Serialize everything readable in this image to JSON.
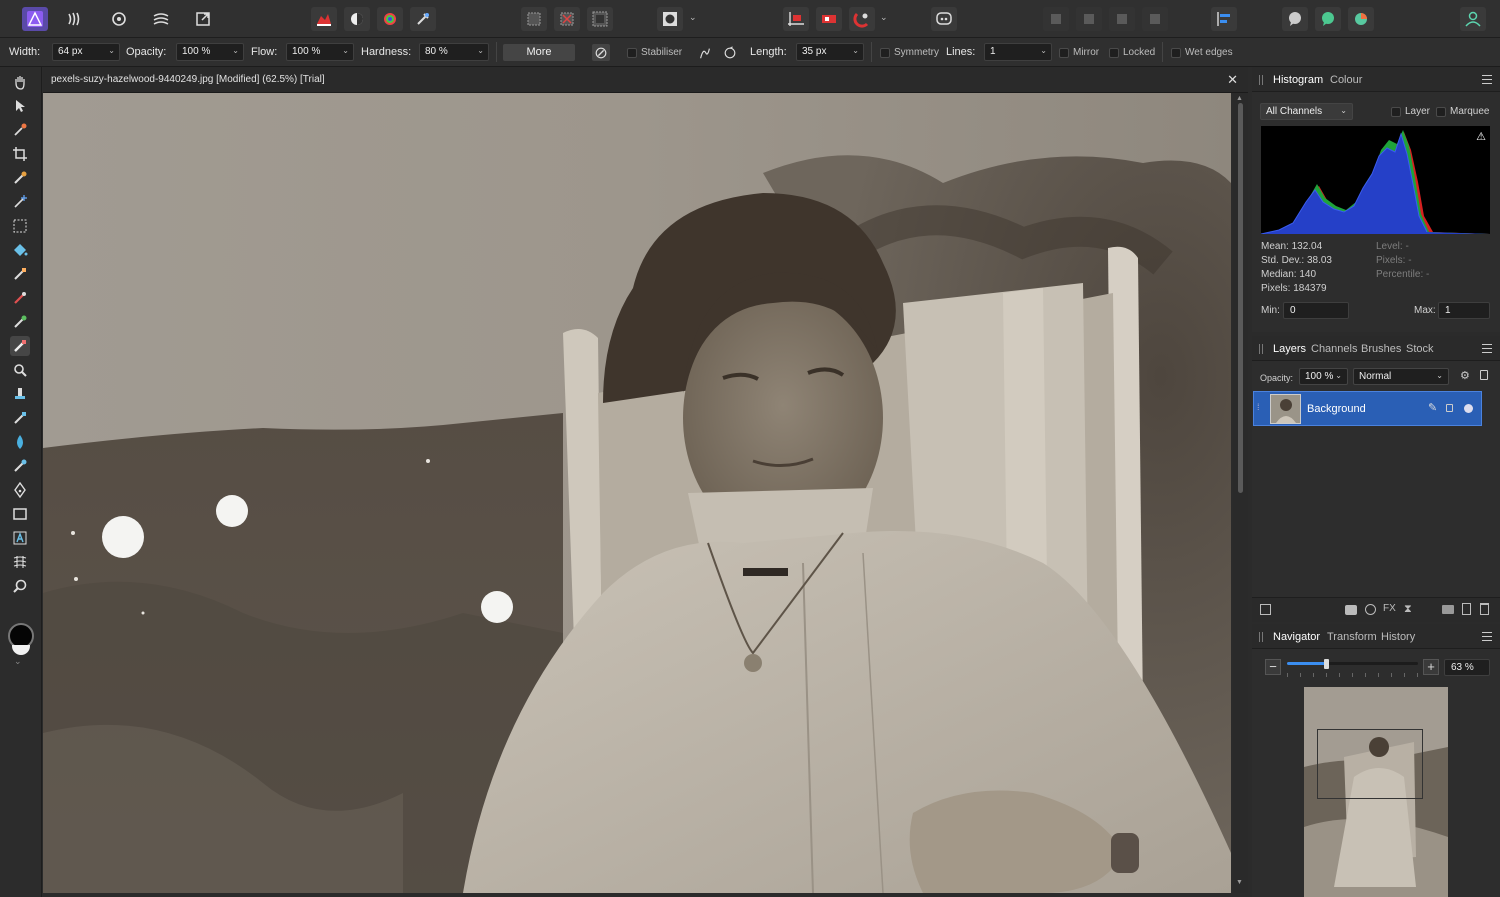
{
  "context_bar": {
    "width_label": "Width:",
    "width_value": "64 px",
    "opacity_label": "Opacity:",
    "opacity_value": "100 %",
    "flow_label": "Flow:",
    "flow_value": "100 %",
    "hardness_label": "Hardness:",
    "hardness_value": "80 %",
    "more_label": "More",
    "stabiliser_label": "Stabiliser",
    "length_label": "Length:",
    "length_value": "35 px",
    "symmetry_label": "Symmetry",
    "lines_label": "Lines:",
    "lines_value": "1",
    "mirror_label": "Mirror",
    "locked_label": "Locked",
    "wet_edges_label": "Wet edges"
  },
  "document": {
    "title": "pexels-suzy-hazelwood-9440249.jpg [Modified] (62.5%) [Trial]",
    "close_glyph": "✕"
  },
  "histogram_panel": {
    "tabs": [
      "Histogram",
      "Colour"
    ],
    "channels_value": "All Channels",
    "layer_label": "Layer",
    "marquee_label": "Marquee",
    "warning_glyph": "⚠",
    "stats": {
      "mean": "Mean: 132.04",
      "std_dev": "Std. Dev.: 38.03",
      "median": "Median: 140",
      "pixels": "Pixels: 184379",
      "level": "Level: -",
      "pixels_sel": "Pixels: -",
      "percentile": "Percentile: -"
    },
    "min_label": "Min:",
    "min_value": "0",
    "max_label": "Max:",
    "max_value": "1"
  },
  "layers_panel": {
    "tabs": [
      "Layers",
      "Channels",
      "Brushes",
      "Stock"
    ],
    "opacity_label": "Opacity:",
    "opacity_value": "100 %",
    "blend_value": "Normal",
    "layer_name": "Background"
  },
  "navigator_panel": {
    "tabs": [
      "Navigator",
      "Transform",
      "History"
    ],
    "zoom_value": "63 %",
    "zoom_level": 0.3,
    "minus_glyph": "−",
    "plus_glyph": "+"
  },
  "colors": {
    "accent": "#3b6fd1",
    "layer_selected": "#2a5fb5",
    "histogram_blue": "#2540c8",
    "histogram_green": "#1fa33a",
    "histogram_red": "#d62020"
  }
}
